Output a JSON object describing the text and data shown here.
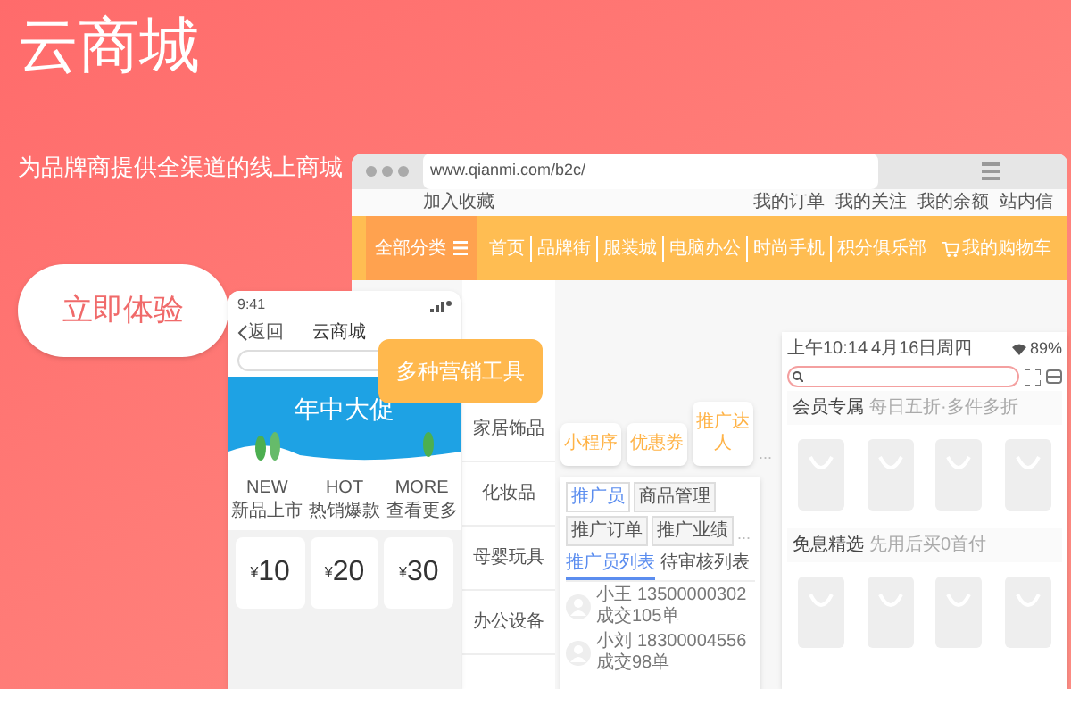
{
  "hero": {
    "title": "云商城",
    "subtitle": "为品牌商提供全渠道的线上商城",
    "cta": "立即体验"
  },
  "browser": {
    "url": "www.qianmi.com/b2c/",
    "favorite_link": "加入收藏",
    "top_links": [
      "我的订单",
      "我的关注",
      "我的余额",
      "站内信"
    ],
    "category_button": "全部分类",
    "nav_items": [
      "首页",
      "品牌街",
      "服装城",
      "电脑办公",
      "时尚手机",
      "积分俱乐部"
    ],
    "cart": "我的购物车",
    "categories": [
      "家居饰品",
      "化妆品",
      "母婴玩具",
      "办公设备"
    ],
    "callout": "多种营销工具",
    "tools": [
      "小程序",
      "优惠券",
      "推广达人"
    ],
    "tools_more": "...",
    "panel": {
      "tabs": [
        {
          "label": "推广员",
          "selected": true
        },
        {
          "label": "商品管理",
          "selected": false
        },
        {
          "label": "推广订单",
          "selected": false
        },
        {
          "label": "推广业绩",
          "selected": false
        }
      ],
      "tabs_more": "...",
      "subtabs": [
        {
          "label": "推广员列表",
          "selected": true
        },
        {
          "label": "待审核列表",
          "selected": false
        }
      ],
      "rows": [
        {
          "name": "小王",
          "phone": "13500000302",
          "deals": "成交105单"
        },
        {
          "name": "小刘",
          "phone": "18300004556",
          "deals": "成交98单"
        }
      ]
    }
  },
  "phone": {
    "time": "9:41",
    "back": "返回",
    "title": "云商城",
    "banner": "年中大促",
    "features": [
      {
        "tag": "NEW",
        "label": "新品上市"
      },
      {
        "tag": "HOT",
        "label": "热销爆款"
      },
      {
        "tag": "MORE",
        "label": "查看更多"
      }
    ],
    "prices": [
      {
        "currency": "¥",
        "amount": "10"
      },
      {
        "currency": "¥",
        "amount": "20"
      },
      {
        "currency": "¥",
        "amount": "30"
      }
    ]
  },
  "tablet": {
    "time": "上午10:14",
    "date": "4月16日周四",
    "battery": "89%",
    "sections": [
      {
        "title": "会员专属",
        "subtitle": "每日五折·多件多折"
      },
      {
        "title": "免息精选",
        "subtitle": "先用后买0首付"
      }
    ]
  }
}
